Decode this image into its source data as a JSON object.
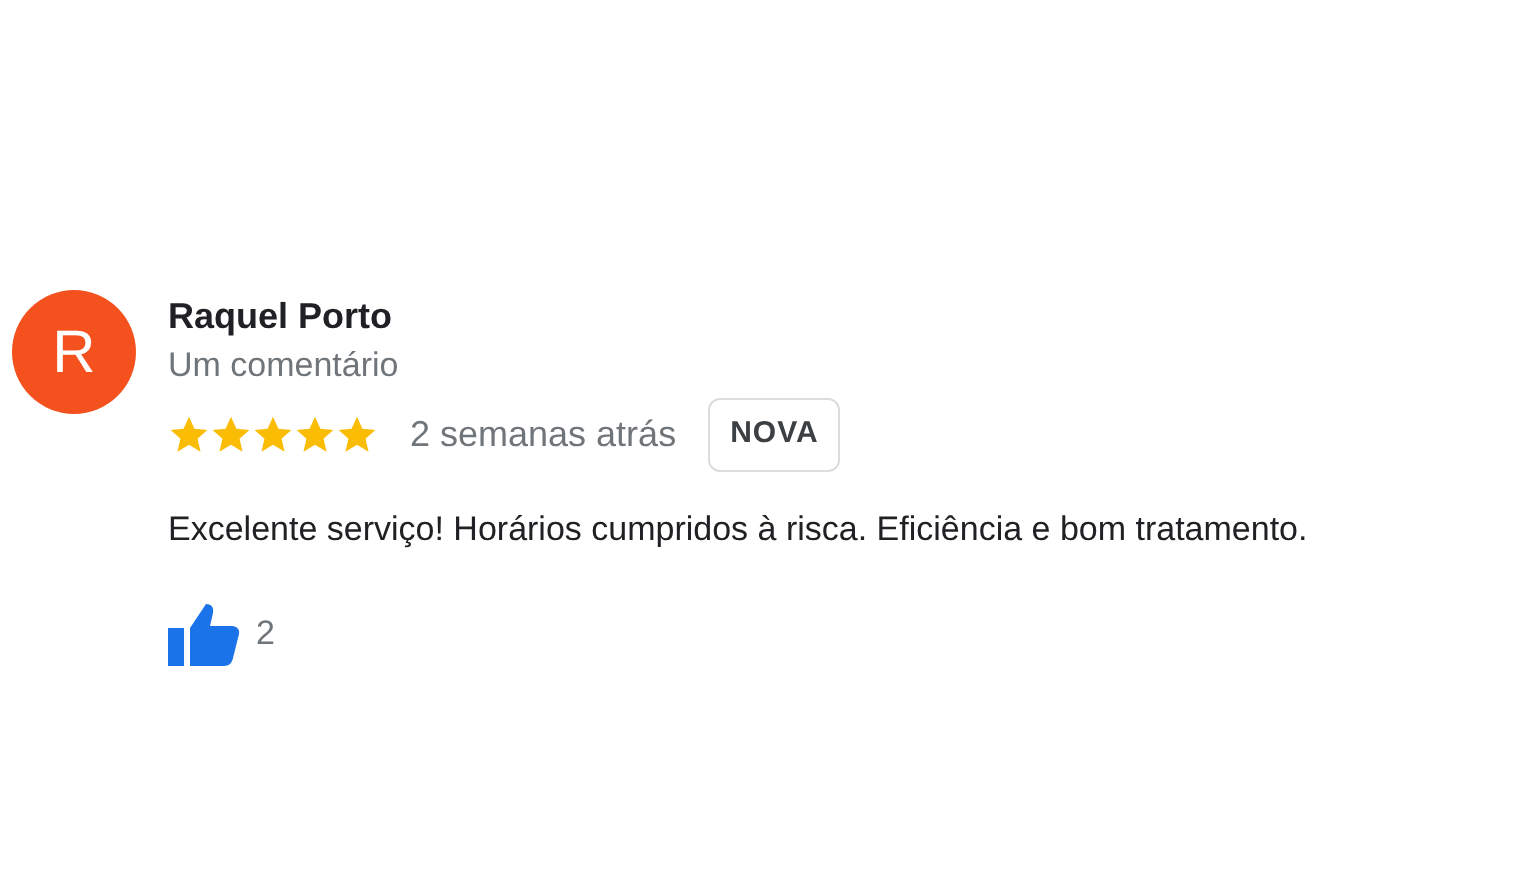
{
  "review": {
    "avatar_letter": "R",
    "color": "#f4511e",
    "author": "Raquel Porto",
    "author_meta": "Um comentário",
    "stars": 5,
    "time": "2 semanas atrás",
    "badge": "NOVA",
    "text": "Excelente serviço! Horários cumpridos à risca. Eficiência e bom tratamento.",
    "likes": "2"
  }
}
